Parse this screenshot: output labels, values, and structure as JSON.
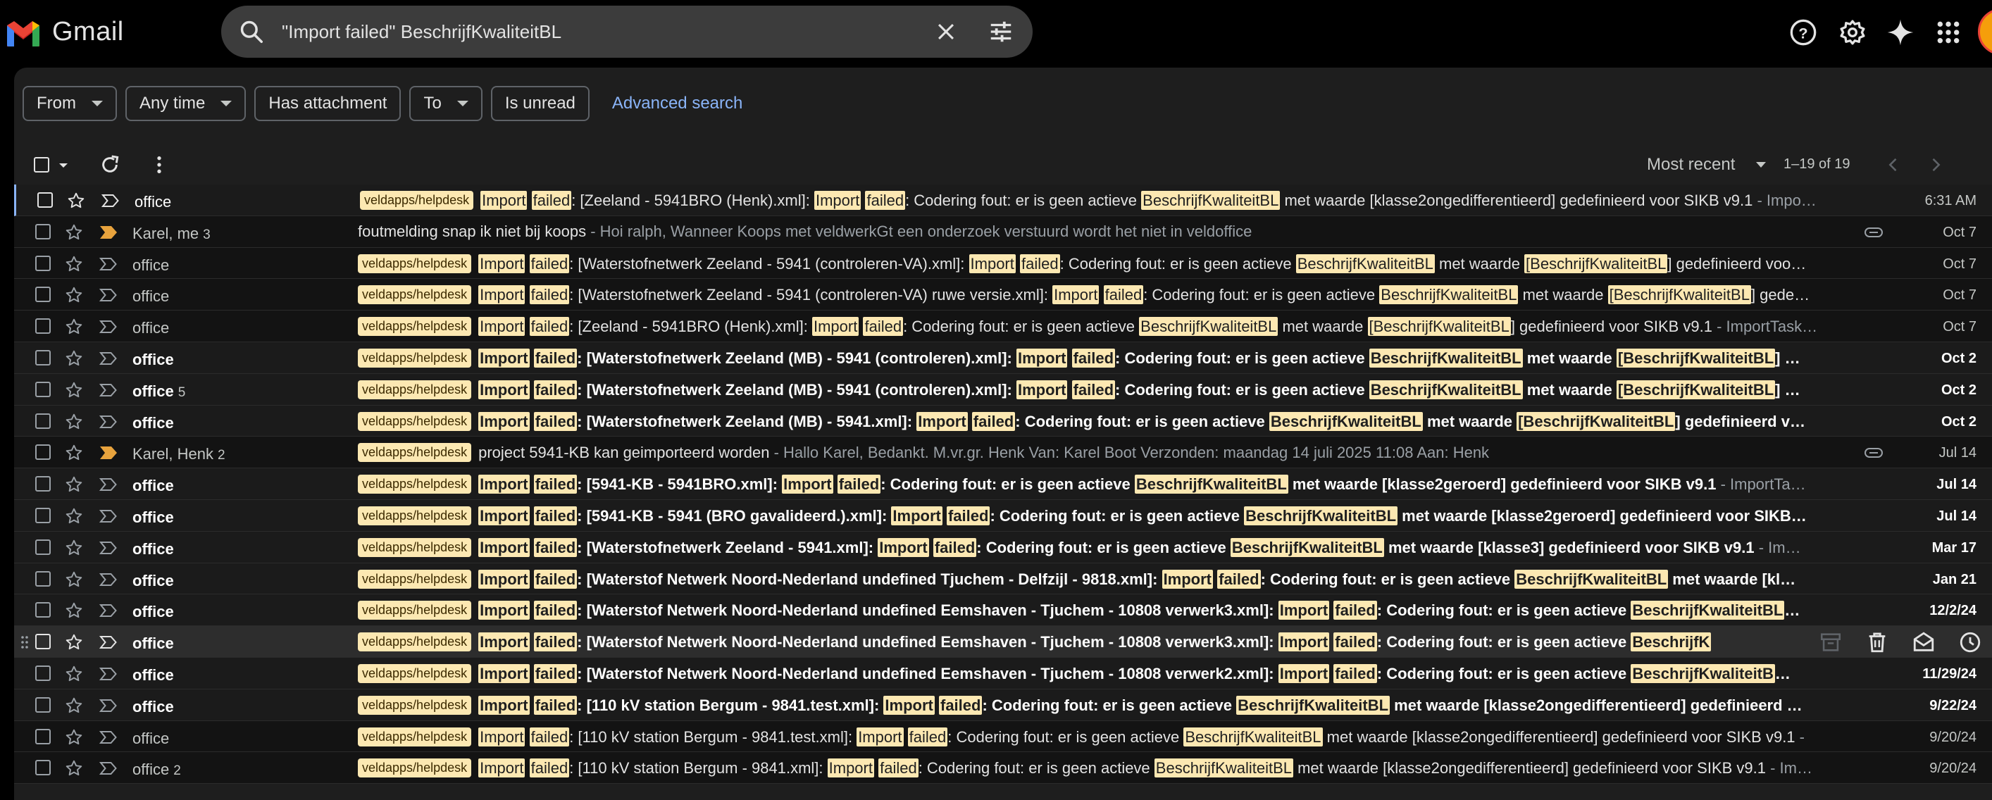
{
  "app": {
    "name": "Gmail"
  },
  "search": {
    "query": "\"Import failed\" BeschrijfKwaliteitBL"
  },
  "filters": [
    {
      "label": "From",
      "dropdown": true
    },
    {
      "label": "Any time",
      "dropdown": true
    },
    {
      "label": "Has attachment",
      "dropdown": false
    },
    {
      "label": "To",
      "dropdown": true
    },
    {
      "label": "Is unread",
      "dropdown": false
    }
  ],
  "advanced_search": "Advanced search",
  "sort": {
    "label": "Most recent"
  },
  "pagination": {
    "range": "1–19 of 19"
  },
  "label_name": "veldapps/helpdesk",
  "colors": {
    "highlight": "#fce8b2",
    "important_marker": "#e8a33d",
    "accent": "#8ab4f8"
  },
  "emails": [
    {
      "sender": "office",
      "count": "",
      "unread": false,
      "selected": true,
      "important": false,
      "label": true,
      "subject": "[[Import]] [[failed]]: [Zeeland - 5941BRO (Henk).xml]: [[Import]] [[failed]]: Codering fout: er is geen actieve [[BeschrijfKwaliteitBL]] met waarde [klasse2ongedifferentieerd] gedefinieerd voor SIKB v9.1",
      "snippet": " - Impo…",
      "date": "6:31 AM"
    },
    {
      "sender": "Karel, me",
      "count": "3",
      "unread": false,
      "important": true,
      "label": false,
      "attachment": true,
      "subject": "foutmelding snap ik niet bij koops",
      "snippet": " - Hoi ralph, Wanneer Koops met veldwerkGt een onderzoek verstuurd wordt het niet in veldoffice",
      "date": "Oct 7"
    },
    {
      "sender": "office",
      "count": "",
      "unread": false,
      "important": false,
      "label": true,
      "subject": "[[Import]] [[failed]]: [Waterstofnetwerk Zeeland - 5941 (controleren-VA).xml]: [[Import]] [[failed]]: Codering fout: er is geen actieve [[BeschrijfKwaliteitBL]] met waarde [[[BeschrijfKwaliteitBL]]] gedefinieerd voo…",
      "snippet": "",
      "date": "Oct 7"
    },
    {
      "sender": "office",
      "count": "",
      "unread": false,
      "important": false,
      "label": true,
      "subject": "[[Import]] [[failed]]: [Waterstofnetwerk Zeeland - 5941 (controleren-VA) ruwe versie.xml]: [[Import]] [[failed]]: Codering fout: er is geen actieve [[BeschrijfKwaliteitBL]] met waarde [[[BeschrijfKwaliteitBL]]] gede…",
      "snippet": "",
      "date": "Oct 7"
    },
    {
      "sender": "office",
      "count": "",
      "unread": false,
      "important": false,
      "label": true,
      "subject": "[[Import]] [[failed]]: [Zeeland - 5941BRO (Henk).xml]: [[Import]] [[failed]]: Codering fout: er is geen actieve [[BeschrijfKwaliteitBL]] met waarde [[[BeschrijfKwaliteitBL]]] gedefinieerd voor SIKB v9.1",
      "snippet": " - ImportTask…",
      "date": "Oct 7"
    },
    {
      "sender": "office",
      "count": "",
      "unread": true,
      "important": false,
      "label": true,
      "subject": "[[Import]] [[failed]]: [Waterstofnetwerk Zeeland (MB) - 5941 (controleren).xml]: [[Import]] [[failed]]: Codering fout: er is geen actieve [[BeschrijfKwaliteitBL]] met waarde [[[BeschrijfKwaliteitBL]]] …",
      "snippet": "",
      "date": "Oct 2"
    },
    {
      "sender": "office",
      "count": "5",
      "unread": true,
      "important": false,
      "label": true,
      "subject": "[[Import]] [[failed]]: [Waterstofnetwerk Zeeland (MB) - 5941 (controleren).xml]: [[Import]] [[failed]]: Codering fout: er is geen actieve [[BeschrijfKwaliteitBL]] met waarde [[[BeschrijfKwaliteitBL]]] …",
      "snippet": "",
      "date": "Oct 2"
    },
    {
      "sender": "office",
      "count": "",
      "unread": true,
      "important": false,
      "label": true,
      "subject": "[[Import]] [[failed]]: [Waterstofnetwerk Zeeland (MB) - 5941.xml]: [[Import]] [[failed]]: Codering fout: er is geen actieve [[BeschrijfKwaliteitBL]] met waarde [[[BeschrijfKwaliteitBL]]] gedefinieerd v…",
      "snippet": "",
      "date": "Oct 2"
    },
    {
      "sender": "Karel, Henk",
      "count": "2",
      "unread": false,
      "important": true,
      "label": true,
      "attachment": true,
      "subject": "project 5941-KB kan geimporteerd worden",
      "snippet": " - Hallo Karel, Bedankt. M.vr.gr. Henk Van: Karel Boot Verzonden: maandag 14 juli 2025 11:08 Aan: Henk",
      "date": "Jul 14"
    },
    {
      "sender": "office",
      "count": "",
      "unread": true,
      "important": false,
      "label": true,
      "subject": "[[Import]] [[failed]]: [5941-KB - 5941BRO.xml]: [[Import]] [[failed]]: Codering fout: er is geen actieve [[BeschrijfKwaliteitBL]] met waarde [klasse2geroerd] gedefinieerd voor SIKB v9.1",
      "snippet": " - ImportTa…",
      "date": "Jul 14"
    },
    {
      "sender": "office",
      "count": "",
      "unread": true,
      "important": false,
      "label": true,
      "subject": "[[Import]] [[failed]]: [5941-KB - 5941 (BRO gavalideerd.).xml]: [[Import]] [[failed]]: Codering fout: er is geen actieve [[BeschrijfKwaliteitBL]] met waarde [klasse2geroerd] gedefinieerd voor SIKB…",
      "snippet": "",
      "date": "Jul 14"
    },
    {
      "sender": "office",
      "count": "",
      "unread": true,
      "important": false,
      "label": true,
      "subject": "[[Import]] [[failed]]: [Waterstofnetwerk Zeeland - 5941.xml]: [[Import]] [[failed]]: Codering fout: er is geen actieve [[BeschrijfKwaliteitBL]] met waarde [klasse3] gedefinieerd voor SIKB v9.1",
      "snippet": " - Im…",
      "date": "Mar 17"
    },
    {
      "sender": "office",
      "count": "",
      "unread": true,
      "important": false,
      "label": true,
      "subject": "[[Import]] [[failed]]: [Waterstof Netwerk Noord-Nederland undefined Tjuchem - Delfzijl - 9818.xml]: [[Import]] [[failed]]: Codering fout: er is geen actieve [[BeschrijfKwaliteitBL]] met waarde [kl…",
      "snippet": "",
      "date": "Jan 21"
    },
    {
      "sender": "office",
      "count": "",
      "unread": true,
      "important": false,
      "label": true,
      "subject": "[[Import]] [[failed]]: [Waterstof Netwerk Noord-Nederland undefined Eemshaven - Tjuchem - 10808 verwerk3.xml]: [[Import]] [[failed]]: Codering fout: er is geen actieve [[BeschrijfKwaliteitBL]]…",
      "snippet": "",
      "date": "12/2/24"
    },
    {
      "sender": "office",
      "count": "",
      "unread": true,
      "important": false,
      "label": true,
      "hover": true,
      "subject": "[[Import]] [[failed]]: [Waterstof Netwerk Noord-Nederland undefined Eemshaven - Tjuchem - 10808 verwerk3.xml]: [[Import]] [[failed]]: Codering fout: er is geen actieve [[BeschrijfK]]",
      "snippet": "",
      "date": ""
    },
    {
      "sender": "office",
      "count": "",
      "unread": true,
      "important": false,
      "label": true,
      "subject": "[[Import]] [[failed]]: [Waterstof Netwerk Noord-Nederland undefined Eemshaven - Tjuchem - 10808 verwerk2.xml]: [[Import]] [[failed]]: Codering fout: er is geen actieve [[BeschrijfKwaliteitB]]…",
      "snippet": "",
      "date": "11/29/24"
    },
    {
      "sender": "office",
      "count": "",
      "unread": true,
      "important": false,
      "label": true,
      "subject": "[[Import]] [[failed]]: [110 kV station Bergum - 9841.test.xml]: [[Import]] [[failed]]: Codering fout: er is geen actieve [[BeschrijfKwaliteitBL]] met waarde [klasse2ongedifferentieerd] gedefinieerd …",
      "snippet": "",
      "date": "9/22/24"
    },
    {
      "sender": "office",
      "count": "",
      "unread": false,
      "important": false,
      "label": true,
      "subject": "[[Import]] [[failed]]: [110 kV station Bergum - 9841.test.xml]: [[Import]] [[failed]]: Codering fout: er is geen actieve [[BeschrijfKwaliteitBL]] met waarde [klasse2ongedifferentieerd] gedefinieerd voor SIKB v9.1",
      "snippet": " -",
      "date": "9/20/24"
    },
    {
      "sender": "office",
      "count": "2",
      "unread": false,
      "important": false,
      "label": true,
      "subject": "[[Import]] [[failed]]: [110 kV station Bergum - 9841.xml]: [[Import]] [[failed]]: Codering fout: er is geen actieve [[BeschrijfKwaliteitBL]] met waarde [klasse2ongedifferentieerd] gedefinieerd voor SIKB v9.1",
      "snippet": " - Im…",
      "date": "9/20/24"
    }
  ]
}
